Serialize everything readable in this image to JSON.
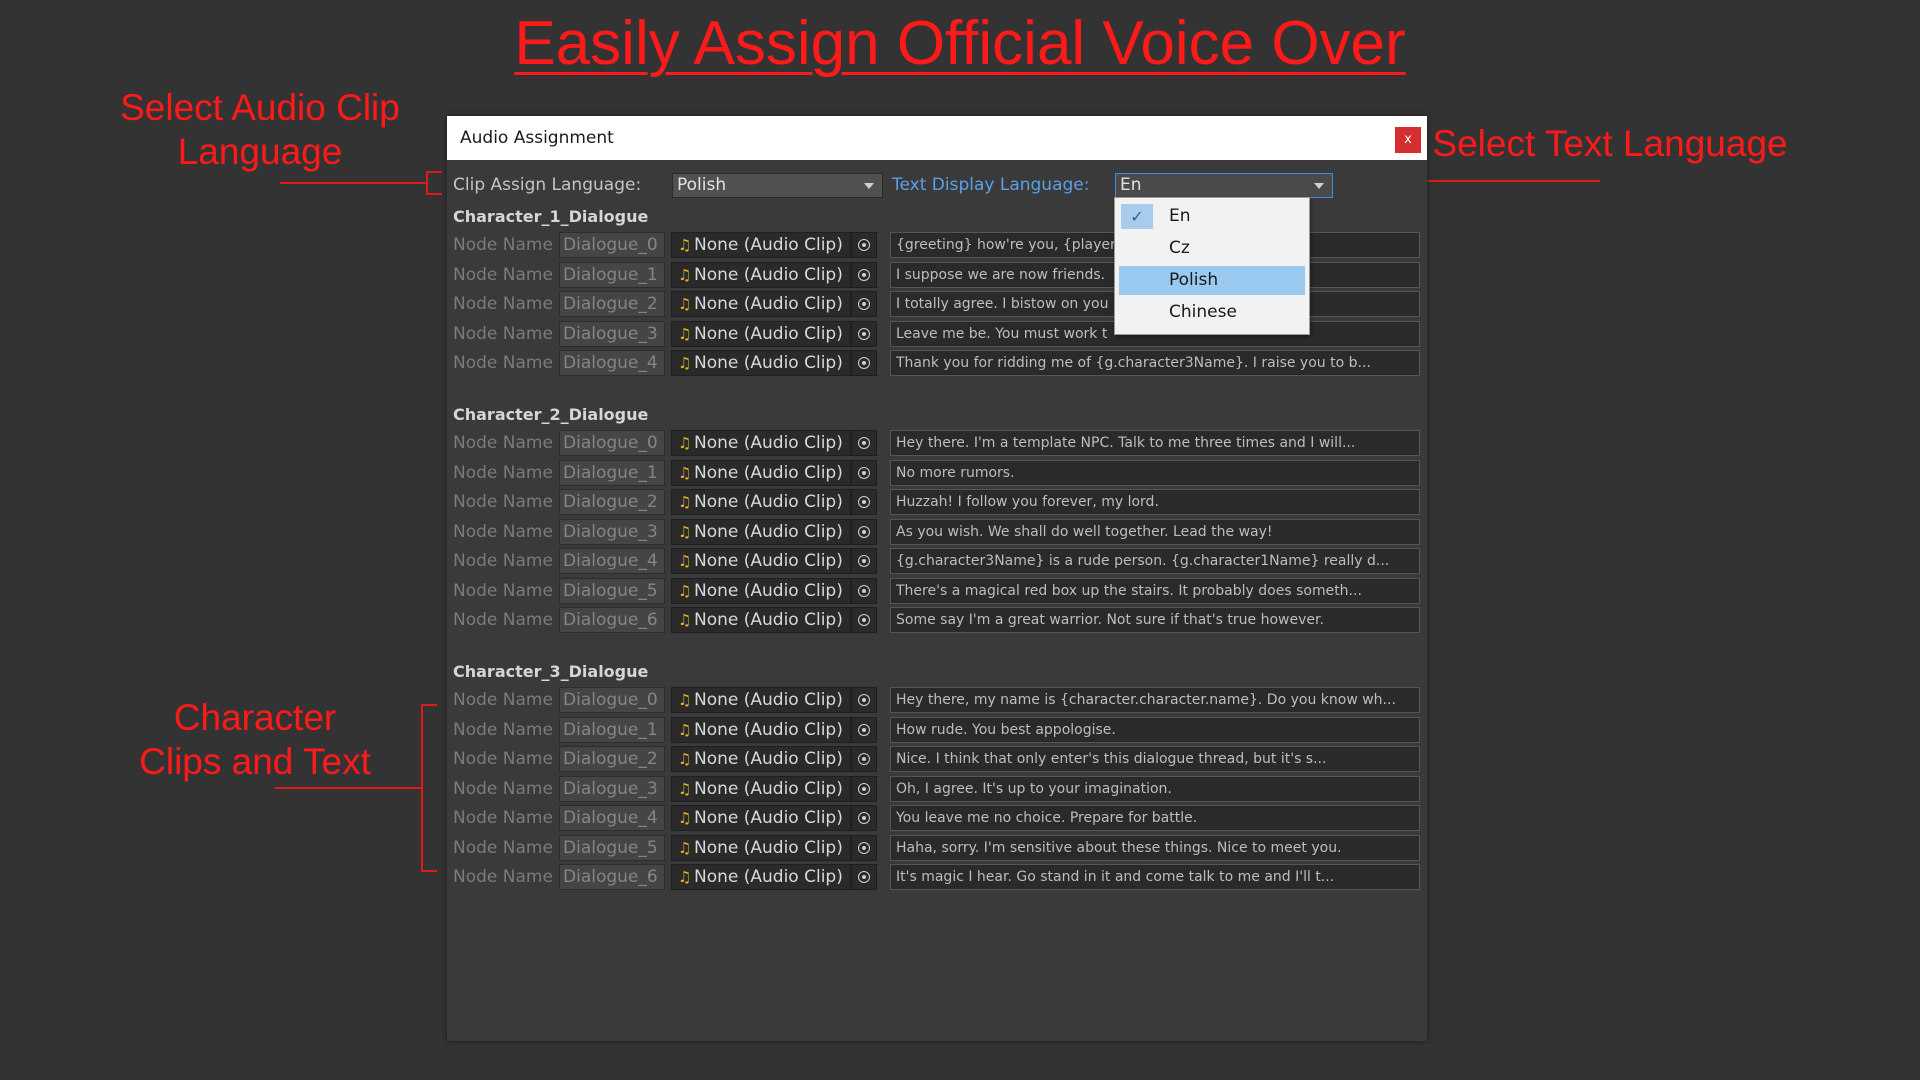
{
  "slide_title": "Easily Assign Official Voice Over",
  "callouts": {
    "audio_clip_language": [
      "Select Audio Clip",
      "Language"
    ],
    "text_language": "Select Text Language",
    "character_clips": [
      "Character",
      "Clips and Text"
    ]
  },
  "window": {
    "title": "Audio Assignment",
    "close_label": "x"
  },
  "toolbar": {
    "clip_assign_label": "Clip Assign Language:",
    "clip_assign_value": "Polish",
    "text_display_label": "Text Display Language:",
    "text_display_value": "En"
  },
  "language_menu": {
    "items": [
      {
        "label": "En",
        "checked": true
      },
      {
        "label": "Cz"
      },
      {
        "label": "Polish",
        "highlighted": true
      },
      {
        "label": "Chinese"
      }
    ]
  },
  "node_label": "Node Name",
  "clip_placeholder": "None (Audio Clip)",
  "sections": [
    {
      "title": "Character_1_Dialogue",
      "rows": [
        {
          "node": "Dialogue_0",
          "text": "{greeting} how're you, {playerN"
        },
        {
          "node": "Dialogue_1",
          "text": "I suppose we are now friends."
        },
        {
          "node": "Dialogue_2",
          "text": "I totally agree. I bistow on you"
        },
        {
          "node": "Dialogue_3",
          "text": "Leave me be. You must work t"
        },
        {
          "node": "Dialogue_4",
          "text": "Thank you for ridding me of {g.character3Name}. I raise you to b..."
        }
      ]
    },
    {
      "title": "Character_2_Dialogue",
      "rows": [
        {
          "node": "Dialogue_0",
          "text": "Hey there. I'm a template NPC. Talk to me three times and I will..."
        },
        {
          "node": "Dialogue_1",
          "text": "No more rumors."
        },
        {
          "node": "Dialogue_2",
          "text": "Huzzah! I follow you forever, my lord."
        },
        {
          "node": "Dialogue_3",
          "text": "As you wish. We shall do well together. Lead the way!"
        },
        {
          "node": "Dialogue_4",
          "text": "{g.character3Name} is a rude person. {g.character1Name} really d..."
        },
        {
          "node": "Dialogue_5",
          "text": "There's a magical red box up the stairs. It probably does someth..."
        },
        {
          "node": "Dialogue_6",
          "text": "Some say I'm a great warrior. Not sure if that's true however."
        }
      ]
    },
    {
      "title": "Character_3_Dialogue",
      "rows": [
        {
          "node": "Dialogue_0",
          "text": "Hey there, my name is {character.character.name}. Do you know wh..."
        },
        {
          "node": "Dialogue_1",
          "text": "How rude. You best appologise."
        },
        {
          "node": "Dialogue_2",
          "text": "Nice. I think that only enter's this dialogue thread, but it's s..."
        },
        {
          "node": "Dialogue_3",
          "text": "Oh, I agree. It's up to your imagination."
        },
        {
          "node": "Dialogue_4",
          "text": "You leave me no choice. Prepare for battle."
        },
        {
          "node": "Dialogue_5",
          "text": "Haha, sorry. I'm sensitive about these things. Nice to meet you."
        },
        {
          "node": "Dialogue_6",
          "text": "It's magic I hear. Go stand in it and come talk to me and I'll t..."
        }
      ]
    }
  ],
  "colors": {
    "background": "#333333",
    "annotation_red": "#ff1a1a",
    "menu_highlight": "#99c9ef",
    "clip_icon": "#e6b422"
  }
}
